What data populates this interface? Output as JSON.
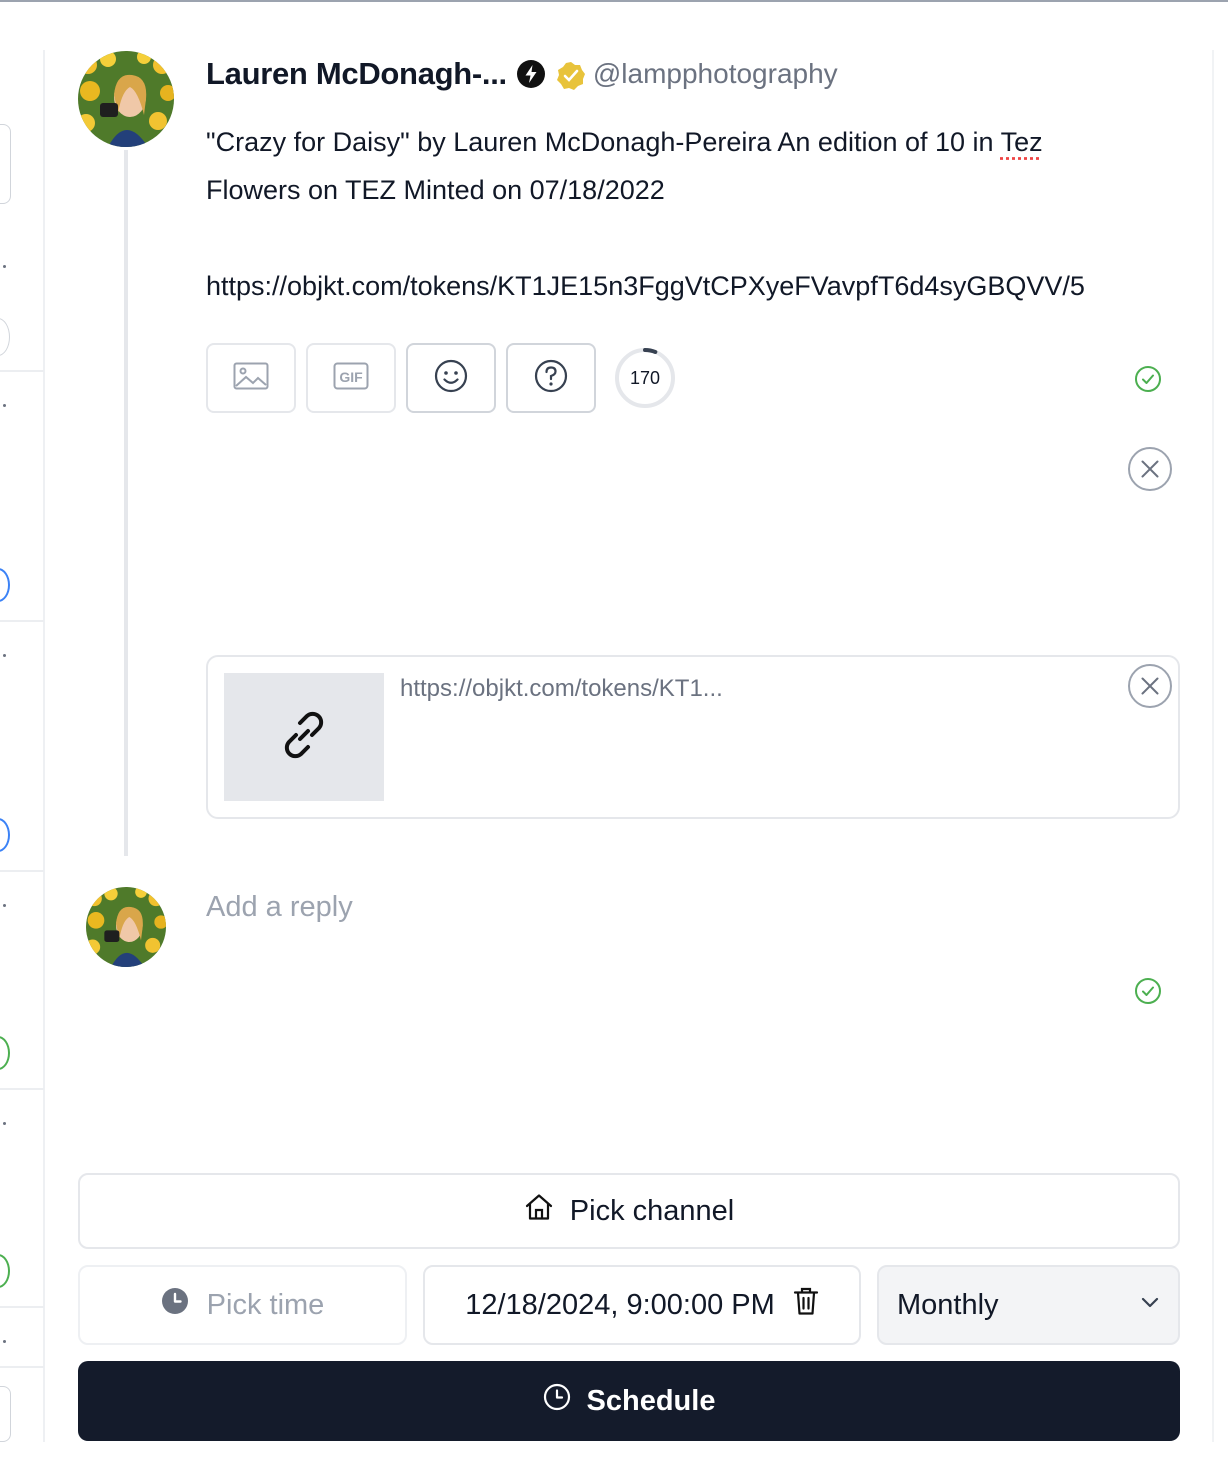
{
  "colors": {
    "primary_button": "#141b2b",
    "check_green": "#4caf50",
    "muted_text": "#6b7280",
    "placeholder_text": "#9ca3af",
    "border": "#e5e7eb",
    "ring_blue": "#3b82f6",
    "ring_green": "#4caf50"
  },
  "post": {
    "author_name": "Lauren McDonagh-...",
    "handle": "@lampphotography",
    "badges": [
      "lightning-badge-icon",
      "verified-badge-icon"
    ],
    "text_line1_prefix": "\"Crazy for Daisy\" by Lauren McDonagh-Pereira An edition of 10 in ",
    "text_line1_flagged": "Tez",
    "text_line2": "Flowers on TEZ Minted on 07/18/2022",
    "text_url": "https://objkt.com/tokens/KT1JE15n3FggVtCPXyeFVavpfT6d4syGBQVV/5"
  },
  "toolbar": {
    "buttons": [
      "image-icon",
      "gif-icon",
      "emoji-icon",
      "help-icon"
    ],
    "char_counter": "170",
    "char_counter_fraction": 0.06
  },
  "link_preview": {
    "url": "https://objkt.com/tokens/KT1..."
  },
  "reply": {
    "placeholder": "Add a reply"
  },
  "footer": {
    "pick_channel_label": "Pick channel",
    "pick_time_label": "Pick time",
    "datetime_value": "12/18/2024, 9:00:00 PM",
    "repeat_value": "Monthly",
    "schedule_label": "Schedule"
  }
}
